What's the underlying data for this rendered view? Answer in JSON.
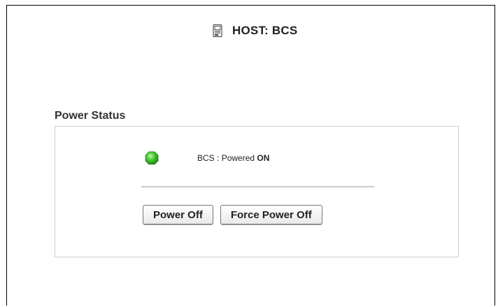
{
  "host": {
    "label": "HOST: BCS",
    "icon": "host-server-icon"
  },
  "power_status": {
    "section_title": "Power Status",
    "status_indicator": {
      "icon": "status-led-icon",
      "color": "#3fbf2f"
    },
    "host_name": "BCS",
    "separator": " : ",
    "state_prefix": "Powered",
    "state_value": "ON",
    "buttons": {
      "power_off": "Power Off",
      "force_power_off": "Force Power Off"
    }
  }
}
